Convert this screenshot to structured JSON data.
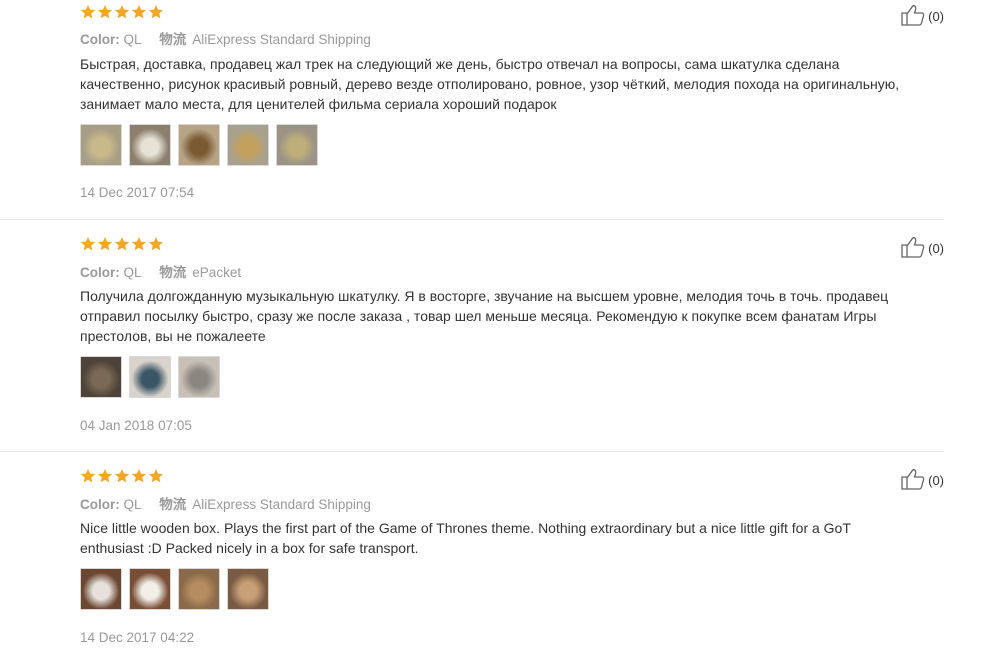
{
  "reviews": [
    {
      "rating": 5,
      "color_label": "Color:",
      "color_value": "QL",
      "shipping_label": "物流",
      "shipping_value": "AliExpress Standard Shipping",
      "text": "Быстрая, доставка, продавец жал трек на следующий же день, быстро отвечал на вопросы, сама шкатулка сделана качественно, рисунок красивый ровный, дерево везде отполировано, ровное, узор чёткий, мелодия похода на оригинальную, занимает мало места, для ценителей фильма сериала хороший подарок",
      "photos": [
        {
          "bg": "#a89e86",
          "fg": "#c9b98a"
        },
        {
          "bg": "#8c7f6c",
          "fg": "#e6e2d6"
        },
        {
          "bg": "#b7a485",
          "fg": "#7a5a33"
        },
        {
          "bg": "#a9a190",
          "fg": "#c2a15c"
        },
        {
          "bg": "#9a9386",
          "fg": "#bfae7a"
        }
      ],
      "date": "14 Dec 2017 07:54",
      "helpful_count": "(0)"
    },
    {
      "rating": 5,
      "color_label": "Color:",
      "color_value": "QL",
      "shipping_label": "物流",
      "shipping_value": "ePacket",
      "text": "Получила долгожданную музыкальную шкатулку. Я в восторге, звучание на высшем уровне, мелодия точь в точь. продавец отправил посылку быстро, сразу же после заказа , товар шел меньше месяца. Рекомендую к покупке всем фанатам Игры престолов, вы не пожалеете",
      "photos": [
        {
          "bg": "#4e4338",
          "fg": "#7a6a55"
        },
        {
          "bg": "#d9d3cb",
          "fg": "#3a5566"
        },
        {
          "bg": "#c8c0b6",
          "fg": "#8a8680"
        }
      ],
      "date": "04 Jan 2018 07:05",
      "helpful_count": "(0)"
    },
    {
      "rating": 5,
      "color_label": "Color:",
      "color_value": "QL",
      "shipping_label": "物流",
      "shipping_value": "AliExpress Standard Shipping",
      "text": "Nice little wooden box. Plays the first part of the Game of Thrones theme. Nothing extraordinary but a nice little gift for a GoT enthusiast :D Packed nicely in a box for safe transport.",
      "photos": [
        {
          "bg": "#6b4630",
          "fg": "#e6e1dc"
        },
        {
          "bg": "#7a4d35",
          "fg": "#f2efe9"
        },
        {
          "bg": "#8a6a4a",
          "fg": "#b58d60"
        },
        {
          "bg": "#7a5a43",
          "fg": "#c8a077"
        }
      ],
      "date": "14 Dec 2017 04:22",
      "helpful_count": "(0)"
    }
  ],
  "colors": {
    "star": "#f5a623",
    "meta": "#999999",
    "text": "#333333",
    "divider": "#e8e8e8"
  },
  "icons": {
    "star": "star-icon",
    "helpful": "thumbs-up-icon"
  }
}
